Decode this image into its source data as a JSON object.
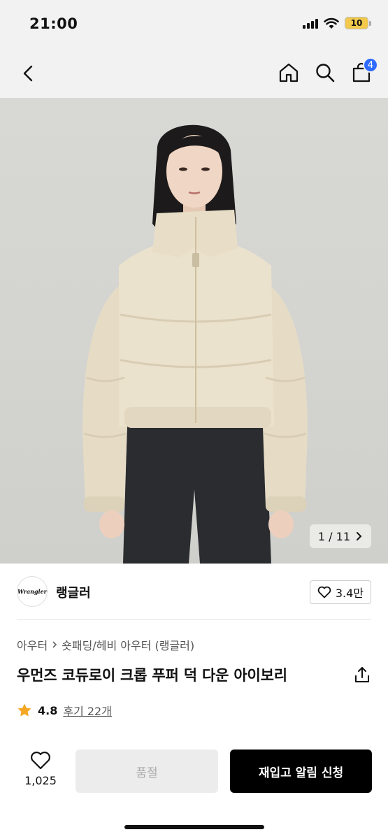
{
  "status_bar": {
    "time": "21:00",
    "battery": "10",
    "battery_color": "#f2c94c"
  },
  "nav": {
    "cart_count": "4",
    "badge_color": "#2f6bff",
    "icons": [
      "back-chevron-icon",
      "home-icon",
      "search-icon",
      "shopping-bag-icon"
    ]
  },
  "gallery": {
    "counter": "1 / 11"
  },
  "brand": {
    "logo_text": "Wrangler",
    "name": "랭글러",
    "likes": "3.4만"
  },
  "product": {
    "breadcrumb": [
      "아우터",
      "숏패딩/헤비 아우터 (랭글러)"
    ],
    "title": "우먼즈 코듀로이 크롭 푸퍼 덕 다운 아이보리",
    "rating": "4.8",
    "review_label": "후기 22개"
  },
  "bottom_bar": {
    "wish_count": "1,025",
    "soldout_label": "품절",
    "restock_label": "재입고 알림 신청"
  }
}
